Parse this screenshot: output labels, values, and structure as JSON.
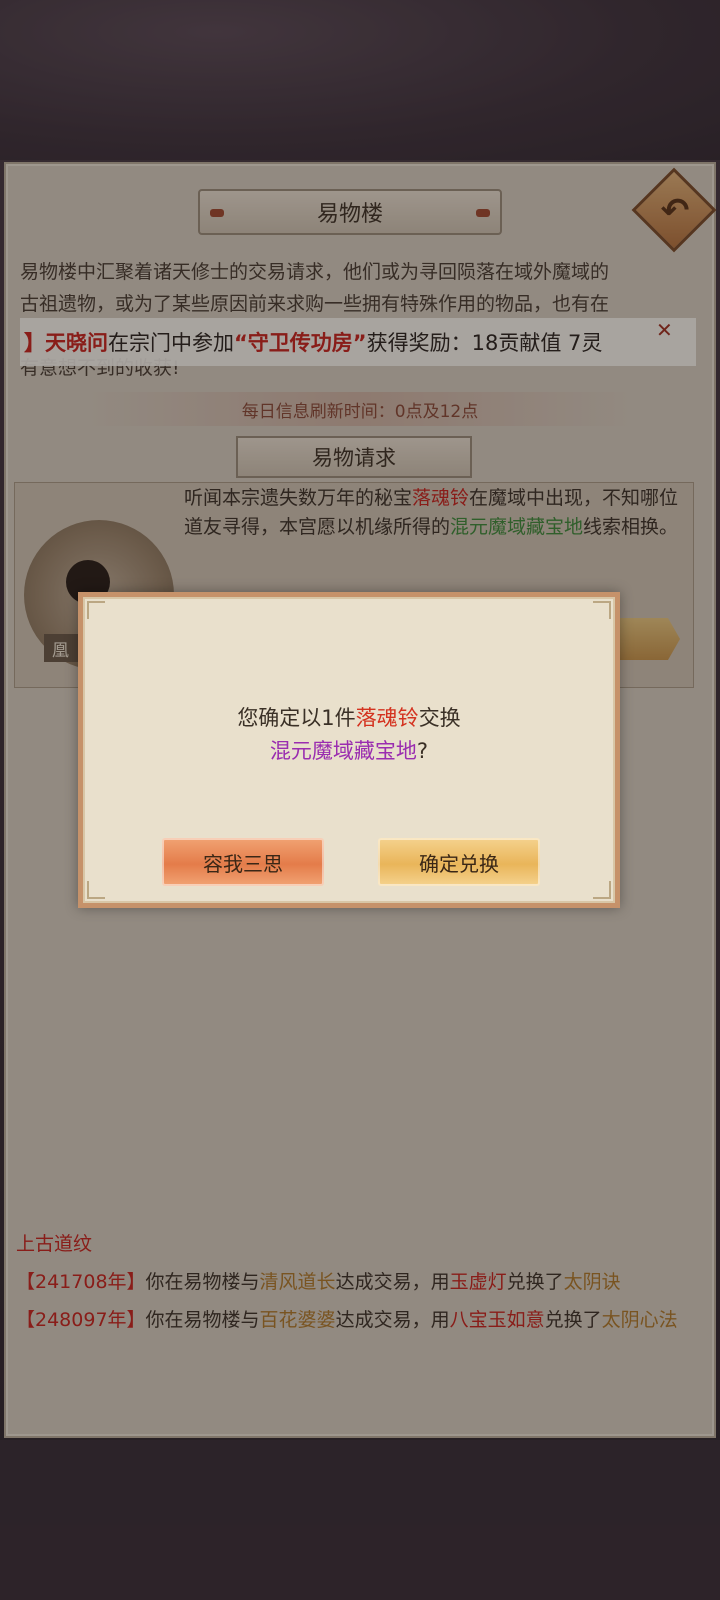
{
  "header": {
    "title": "易物楼"
  },
  "intro": {
    "line1": "易物楼中汇聚着诸天修士的交易请求，他们或为寻回陨落在域外魔域的",
    "line2": "古祖遗物，或为了某些原因前来求购一些拥有特殊作用的物品，也有在",
    "line3": "有意想不到的收获!"
  },
  "ticker": {
    "prefix": "】",
    "player": "天晓问",
    "text1": "在宗门中参加",
    "activity": "“守卫传功房”",
    "text2": "获得奖励：18贡献值 7灵"
  },
  "refresh_text": "每日信息刷新时间：0点及12点",
  "section_title": "易物请求",
  "request": {
    "npc_name": "凰",
    "t1": "听闻本宗遗失数万年的秘宝",
    "item": "落魂铃",
    "t2": "在魔域中出现，不知哪位道友寻得，本宫愿以机缘所得的",
    "reward": "混元魔域藏宝地",
    "t3": "线索相换。"
  },
  "dialog": {
    "m1": "您确定以1件",
    "item": "落魂铃",
    "m2": "交换",
    "reward": "混元魔域藏宝地",
    "m3": "?",
    "cancel_label": "容我三思",
    "confirm_label": "确定兑换"
  },
  "log": [
    {
      "tail": "上古道纹"
    },
    {
      "year": "【241708年】",
      "t1": "你在易物楼与",
      "name": "清风道长",
      "t2": "达成交易，用",
      "item": "玉虚灯",
      "t3": "兑换了",
      "reward": "太阴诀"
    },
    {
      "year": "【248097年】",
      "t1": "你在易物楼与",
      "name": "百花婆婆",
      "t2": "达成交易，用",
      "item": "八宝玉如意",
      "t3": "兑换了",
      "reward": "太阴心法"
    }
  ]
}
